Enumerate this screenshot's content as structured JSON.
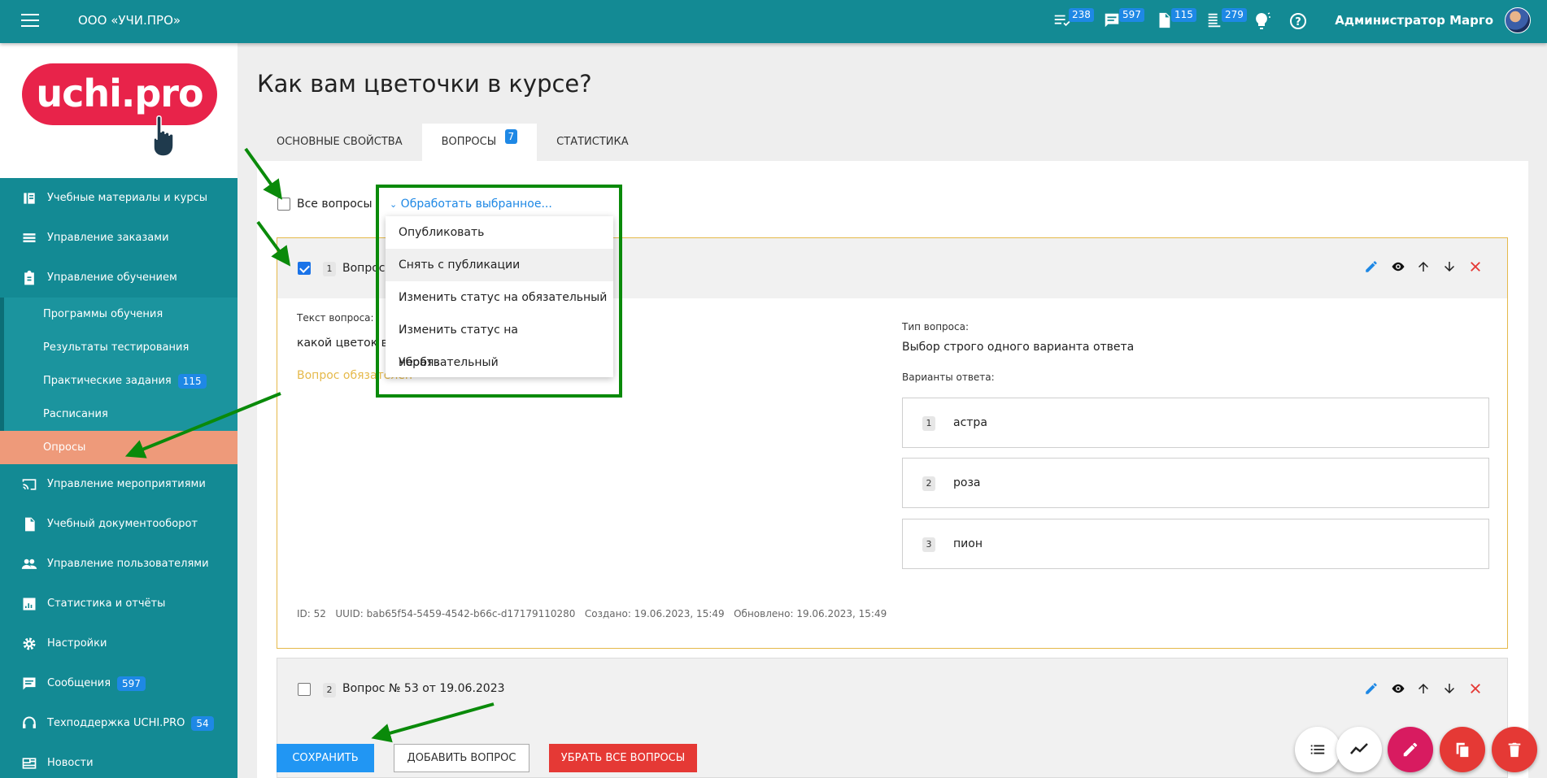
{
  "topbar": {
    "org": "ООО «УЧИ.ПРО»",
    "badges": {
      "tasks": "238",
      "messages": "597",
      "documents": "115",
      "lists": "279"
    },
    "user": "Администратор Марго"
  },
  "logo": {
    "text": "uchi.pro"
  },
  "sidebar": {
    "items": [
      {
        "label": "Учебные материалы и курсы",
        "icon": "book-icon"
      },
      {
        "label": "Управление заказами",
        "icon": "list-icon"
      },
      {
        "label": "Управление обучением",
        "icon": "clipboard-icon"
      }
    ],
    "sub": [
      {
        "label": "Программы обучения"
      },
      {
        "label": "Результаты тестирования"
      },
      {
        "label": "Практические задания",
        "badge": "115"
      },
      {
        "label": "Расписания"
      },
      {
        "label": "Опросы"
      }
    ],
    "items2": [
      {
        "label": "Управление мероприятиями",
        "icon": "cast-icon"
      },
      {
        "label": "Учебный документооборот",
        "icon": "document-icon"
      },
      {
        "label": "Управление пользователями",
        "icon": "users-icon"
      },
      {
        "label": "Статистика и отчёты",
        "icon": "chart-icon"
      },
      {
        "label": "Настройки",
        "icon": "gear-icon"
      },
      {
        "label": "Сообщения",
        "icon": "message-icon",
        "badge": "597"
      },
      {
        "label": "Техподдержка UCHI.PRO",
        "icon": "support-icon",
        "badge": "54"
      },
      {
        "label": "Новости",
        "icon": "news-icon"
      }
    ]
  },
  "page": {
    "title": "Как вам цветочки в курсе?",
    "tabs": [
      {
        "label": "ОСНОВНЫЕ СВОЙСТВА"
      },
      {
        "label": "ВОПРОСЫ",
        "badge": "7"
      },
      {
        "label": "СТАТИСТИКА"
      }
    ]
  },
  "toolbar": {
    "all_label": "Все вопросы",
    "process_label": "Обработать выбранное..."
  },
  "dropdown": {
    "items": [
      "Опубликовать",
      "Снять с публикации",
      "Изменить статус на обязательный",
      "Изменить статус на необязательный",
      "Убрать"
    ]
  },
  "question1": {
    "num": "1",
    "title_visible": "Вопрос",
    "text_label": "Текст вопроса:",
    "text_visible": "какой цветок ва",
    "required_visible": "Вопрос обязателен",
    "type_label": "Тип вопроса:",
    "type_value": "Выбор строго одного варианта ответа",
    "answers_label": "Варианты ответа:",
    "answers": [
      {
        "num": "1",
        "text": "астра"
      },
      {
        "num": "2",
        "text": "роза"
      },
      {
        "num": "3",
        "text": "пион"
      }
    ],
    "meta": {
      "id_label": "ID:",
      "id": "52",
      "uuid_label": "UUID:",
      "uuid": "bab65f54-5459-4542-b66c-d17179110280",
      "created_label": "Создано:",
      "created": "19.06.2023, 15:49",
      "updated_label": "Обновлено:",
      "updated": "19.06.2023, 15:49"
    }
  },
  "question2": {
    "num": "2",
    "title": "Вопрос № 53 от 19.06.2023"
  },
  "buttons": {
    "save": "СОХРАНИТЬ",
    "add": "ДОБАВИТЬ ВОПРОС",
    "remove_all": "УБРАТЬ ВСЕ ВОПРОСЫ"
  },
  "colors": {
    "teal": "#138a94",
    "active_nav": "#ee9a7a",
    "badge_blue": "#1e88e5",
    "required_yellow": "#e5b94a",
    "annotation_green": "#0a8a0a",
    "fab_pink": "#d81b60",
    "fab_red": "#e53935"
  }
}
